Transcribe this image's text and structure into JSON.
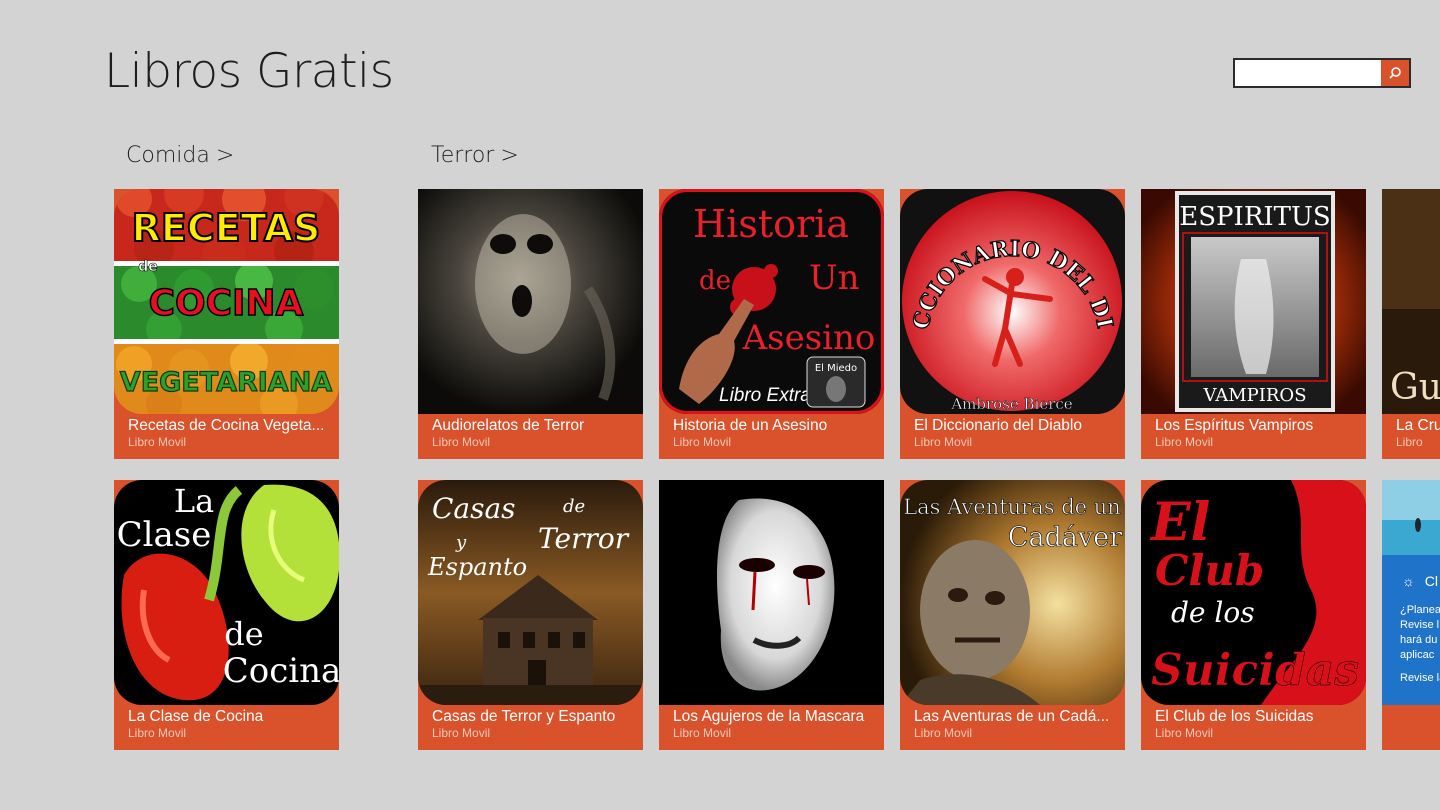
{
  "app": {
    "title": "Libros Gratis"
  },
  "search": {
    "value": "",
    "placeholder": "",
    "button_icon": "search-icon"
  },
  "groups": [
    {
      "label": "Comida",
      "chevron": ">"
    },
    {
      "label": "Terror",
      "chevron": ">"
    }
  ],
  "covers": {
    "recetas": {
      "l1": "RECETAS",
      "l2": "de",
      "l3": "COCINA",
      "l4": "VEGETARIANA"
    },
    "clase": {
      "l1": "La",
      "l2": "Clase",
      "l3": "de",
      "l4": "Cocina"
    },
    "historia": {
      "l1": "Historia",
      "l2": "de",
      "l3": "Un",
      "l4": "Asesino",
      "l5": "Libro Extra",
      "l6": "El Miedo"
    },
    "diccionario": {
      "l1": "EL DICCIONARIO DEL DIABLO",
      "l2": "Ambrose Bierce"
    },
    "espiritus": {
      "l1": "ESPIRITUS",
      "l2": "VAMPIROS"
    },
    "casas": {
      "l1": "Casas",
      "l2": "de",
      "l3": "y",
      "l4": "Terror",
      "l5": "Espanto"
    },
    "aventuras": {
      "l1": "Las Aventuras de un",
      "l2": "Cadáver"
    },
    "club": {
      "l1": "El",
      "l2": "Club",
      "l3": "de los",
      "l4": "Suicidas"
    },
    "partial1": {
      "l1": "Gusta"
    },
    "partial2": {
      "l1": "Cl",
      "l2": "¿Planea",
      "l3": "Revise l",
      "l4": "hará du",
      "l5": "aplicac",
      "l6": "Revise la"
    }
  },
  "tiles": [
    {
      "title": "Recetas de Cocina Vegeta...",
      "subtitle": "Libro Movil"
    },
    {
      "title": "La Clase de Cocina",
      "subtitle": "Libro Movil"
    },
    {
      "title": "Audiorelatos de Terror",
      "subtitle": "Libro Movil"
    },
    {
      "title": "Casas de Terror y Espanto",
      "subtitle": "Libro Movil"
    },
    {
      "title": "Historia de un Asesino",
      "subtitle": "Libro Movil"
    },
    {
      "title": "Los Agujeros de la Mascara",
      "subtitle": "Libro Movil"
    },
    {
      "title": "El Diccionario del Diablo",
      "subtitle": "Libro Movil"
    },
    {
      "title": "Las Aventuras de un Cadá...",
      "subtitle": "Libro Movil"
    },
    {
      "title": "Los Espíritus Vampiros",
      "subtitle": "Libro Movil"
    },
    {
      "title": "El Club de los Suicidas",
      "subtitle": "Libro Movil"
    },
    {
      "title": "La Cru",
      "subtitle": "Libro"
    },
    {
      "title": "",
      "subtitle": ""
    }
  ],
  "colors": {
    "background": "#d3d3d3",
    "accent": "#d9522b",
    "caption_subtitle": "#f5c8b8",
    "ad_blue": "#1f73c8"
  }
}
